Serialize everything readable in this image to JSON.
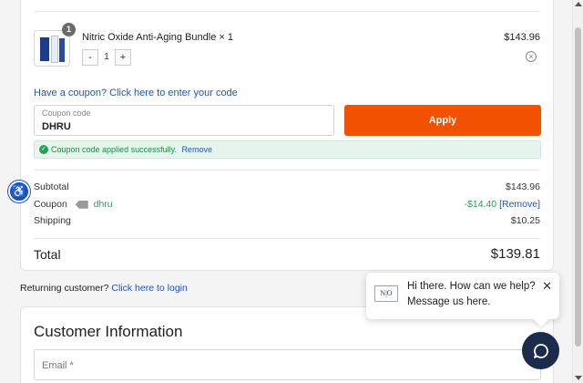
{
  "order": {
    "product": {
      "name": "Nitric Oxide Anti-Aging Bundle × 1",
      "price": "$143.96",
      "badge_qty": "1",
      "stepper": {
        "minus": "-",
        "value": "1",
        "plus": "+"
      },
      "remove_icon": "⊗"
    },
    "coupon_link": "Have a coupon? Click here to enter your code",
    "coupon_field": {
      "label": "Coupon code",
      "value": "DHRU"
    },
    "apply_label": "Apply",
    "success": {
      "text": "Coupon code applied successfully.",
      "remove": "Remove"
    },
    "summary": {
      "subtotal_label": "Subtotal",
      "subtotal_value": "$143.96",
      "coupon_label": "Coupon",
      "coupon_code": "dhru",
      "coupon_discount": "-$14.40",
      "coupon_remove": "[Remove]",
      "shipping_label": "Shipping",
      "shipping_value": "$10.25",
      "total_label": "Total",
      "total_value": "$139.81"
    }
  },
  "returning": {
    "text": "Returning customer?",
    "link": "Click here to login"
  },
  "customer": {
    "title": "Customer Information",
    "email_placeholder": "Email *"
  },
  "chat": {
    "logo_text": "N|O",
    "line1": "Hi there. How can we help?",
    "line2": "Message us here.",
    "close": "✕"
  },
  "colors": {
    "apply": "#f25100",
    "link": "#1a57c0",
    "success": "#22a355",
    "chat": "#1a2b4c"
  },
  "icons": {
    "accessibility": "accessibility-icon",
    "chat": "chat-bubble-icon"
  }
}
